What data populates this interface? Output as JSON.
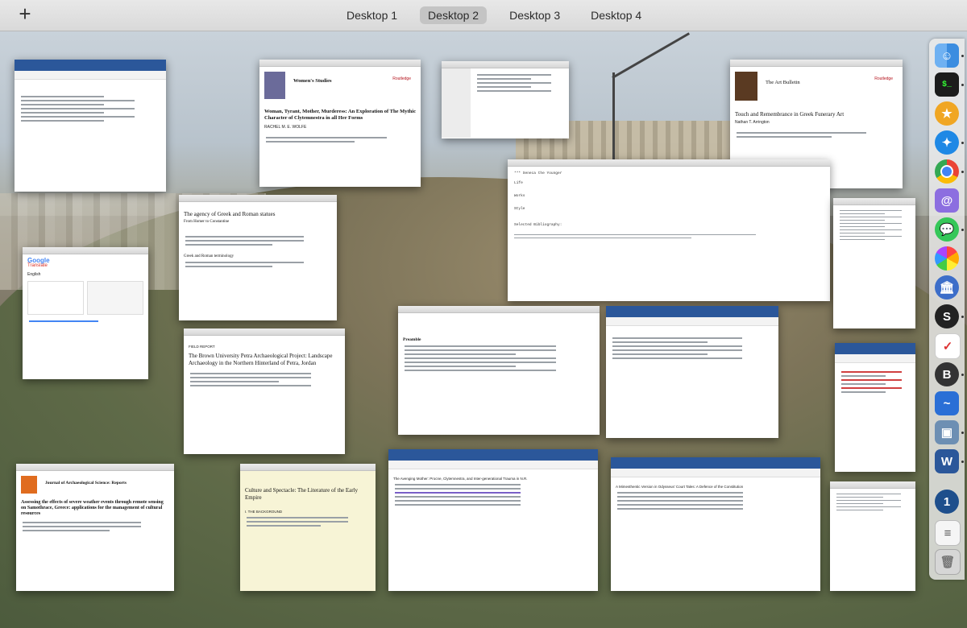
{
  "top_bar": {
    "add_label": "+",
    "spaces": [
      {
        "label": "Desktop 1",
        "active": false
      },
      {
        "label": "Desktop 2",
        "active": true
      },
      {
        "label": "Desktop 3",
        "active": false
      },
      {
        "label": "Desktop 4",
        "active": false
      }
    ]
  },
  "windows": {
    "womens_studies": {
      "journal": "Women's Studies",
      "title": "Woman, Tyrant, Mother, Murderess: An Exploration of The Mythic Character of Clytemnestra in all Her Forms",
      "author": "RACHEL M. E. WOLFE",
      "publisher": "Routledge"
    },
    "art_bulletin": {
      "journal": "The Art Bulletin",
      "title": "Touch and Remembrance in Greek Funerary Art",
      "author": "Nathan T. Arrington",
      "publisher": "Routledge"
    },
    "agency": {
      "title": "The agency of Greek and Roman statues",
      "subtitle": "From Homer to Constantine",
      "section": "Greek and Roman terminology"
    },
    "seneca": {
      "line1": "*** Seneca the Younger",
      "line2": "Life",
      "line3": "Works",
      "line4": "Style",
      "line5": "Selected Bibliography:"
    },
    "translate": {
      "app": "Google",
      "label": "Translate",
      "detected": "English"
    },
    "petra": {
      "kicker": "FIELD REPORT",
      "title": "The Brown University Petra Archaeological Project: Landscape Archaeology in the Northern Hinterland of Petra, Jordan"
    },
    "preamble": {
      "heading": "Preamble"
    },
    "jas": {
      "journal": "Journal of Archaeological Science: Reports",
      "title": "Assessing the effects of severe weather events through remote sensing on Samothrace, Greece: applications for the management of cultural resources"
    },
    "culture": {
      "title": "Culture and Spectacle: The Literature of the Early Empire",
      "section": "I. THE BACKGROUND"
    },
    "avenging": {
      "heading": "The Avenging Mother: Procne, Clytemnestra, and Inter-generational Trauma in N.R."
    },
    "mimesis": {
      "heading": "A Mimesthentic Version in Odysseus' Court Tales: A Defence of the Constitution"
    }
  },
  "dock": {
    "items": [
      "Finder",
      "Terminal",
      "Reeder",
      "Safari",
      "Chrome",
      "Contacts",
      "Messages",
      "Photos",
      "Library",
      "Scrivener",
      "Todoist",
      "BBEdit",
      "Paw",
      "Preview",
      "Word",
      "1Password",
      "TextEdit",
      "Trash"
    ]
  }
}
